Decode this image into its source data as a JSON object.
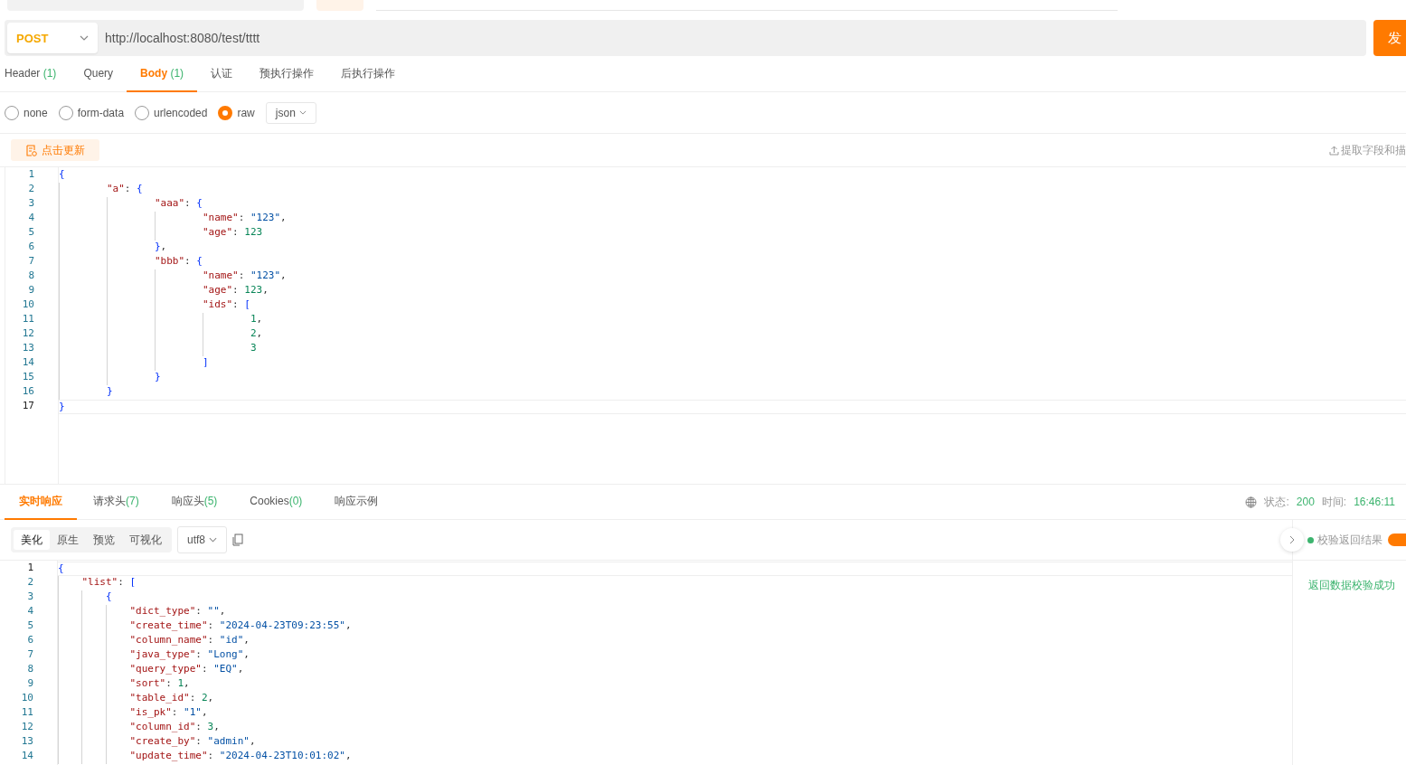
{
  "request": {
    "method": "POST",
    "url": "http://localhost:8080/test/tttt",
    "send_label": "发"
  },
  "request_tabs": [
    {
      "label": "Header",
      "count": "(1)",
      "selected": false
    },
    {
      "label": "Query",
      "selected": false
    },
    {
      "label": "Body",
      "count": "(1)",
      "selected": true
    },
    {
      "label": "认证",
      "selected": false
    },
    {
      "label": "预执行操作",
      "selected": false
    },
    {
      "label": "后执行操作",
      "selected": false
    }
  ],
  "body_modes": [
    {
      "label": "none",
      "selected": false
    },
    {
      "label": "form-data",
      "selected": false
    },
    {
      "label": "urlencoded",
      "selected": false
    },
    {
      "label": "raw",
      "selected": true
    }
  ],
  "body_format": "json",
  "update_button": "点击更新",
  "extract_link": "提取字段和描",
  "body_code": {
    "lines": [
      {
        "number": "1",
        "text": "{",
        "active": false
      },
      {
        "number": "2",
        "text": "        \"a\": {",
        "active": false
      },
      {
        "number": "3",
        "text": "                \"aaa\": {",
        "active": false
      },
      {
        "number": "4",
        "text": "                        \"name\": \"123\",",
        "active": false
      },
      {
        "number": "5",
        "text": "                        \"age\": 123",
        "active": false
      },
      {
        "number": "6",
        "text": "                },",
        "active": false
      },
      {
        "number": "7",
        "text": "                \"bbb\": {",
        "active": false
      },
      {
        "number": "8",
        "text": "                        \"name\": \"123\",",
        "active": false
      },
      {
        "number": "9",
        "text": "                        \"age\": 123,",
        "active": false
      },
      {
        "number": "10",
        "text": "                        \"ids\": [",
        "active": false
      },
      {
        "number": "11",
        "text": "                                1,",
        "active": false
      },
      {
        "number": "12",
        "text": "                                2,",
        "active": false
      },
      {
        "number": "13",
        "text": "                                3",
        "active": false
      },
      {
        "number": "14",
        "text": "                        ]",
        "active": false
      },
      {
        "number": "15",
        "text": "                }",
        "active": false
      },
      {
        "number": "16",
        "text": "        }",
        "active": false
      },
      {
        "number": "17",
        "text": "}",
        "active": true
      }
    ]
  },
  "response_tabs": [
    {
      "label": "实时响应",
      "selected": true
    },
    {
      "label": "请求头",
      "count": "(7)",
      "selected": false
    },
    {
      "label": "响应头",
      "count": "(5)",
      "selected": false
    },
    {
      "label": "Cookies",
      "count": "(0)",
      "selected": false
    },
    {
      "label": "响应示例",
      "selected": false
    }
  ],
  "status": {
    "status_label": "状态:",
    "status_value": "200",
    "time_label": "时间:",
    "time_value": "16:46:11"
  },
  "view_modes": [
    {
      "label": "美化",
      "selected": true
    },
    {
      "label": "原生",
      "selected": false
    },
    {
      "label": "预览",
      "selected": false
    },
    {
      "label": "可视化",
      "selected": false
    }
  ],
  "encoding": "utf8",
  "validation": {
    "label": "校验返回结果",
    "on": true,
    "message": "返回数据校验成功"
  },
  "response_code": {
    "lines": [
      {
        "number": "1",
        "text": "{",
        "active": true
      },
      {
        "number": "2",
        "text": "    \"list\": [",
        "active": false
      },
      {
        "number": "3",
        "text": "        {",
        "active": false
      },
      {
        "number": "4",
        "text": "            \"dict_type\": \"\",",
        "active": false
      },
      {
        "number": "5",
        "text": "            \"create_time\": \"2024-04-23T09:23:55\",",
        "active": false
      },
      {
        "number": "6",
        "text": "            \"column_name\": \"id\",",
        "active": false
      },
      {
        "number": "7",
        "text": "            \"java_type\": \"Long\",",
        "active": false
      },
      {
        "number": "8",
        "text": "            \"query_type\": \"EQ\",",
        "active": false
      },
      {
        "number": "9",
        "text": "            \"sort\": 1,",
        "active": false
      },
      {
        "number": "10",
        "text": "            \"table_id\": 2,",
        "active": false
      },
      {
        "number": "11",
        "text": "            \"is_pk\": \"1\",",
        "active": false
      },
      {
        "number": "12",
        "text": "            \"column_id\": 3,",
        "active": false
      },
      {
        "number": "13",
        "text": "            \"create_by\": \"admin\",",
        "active": false
      },
      {
        "number": "14",
        "text": "            \"update_time\": \"2024-04-23T10:01:02\",",
        "active": false
      }
    ]
  }
}
